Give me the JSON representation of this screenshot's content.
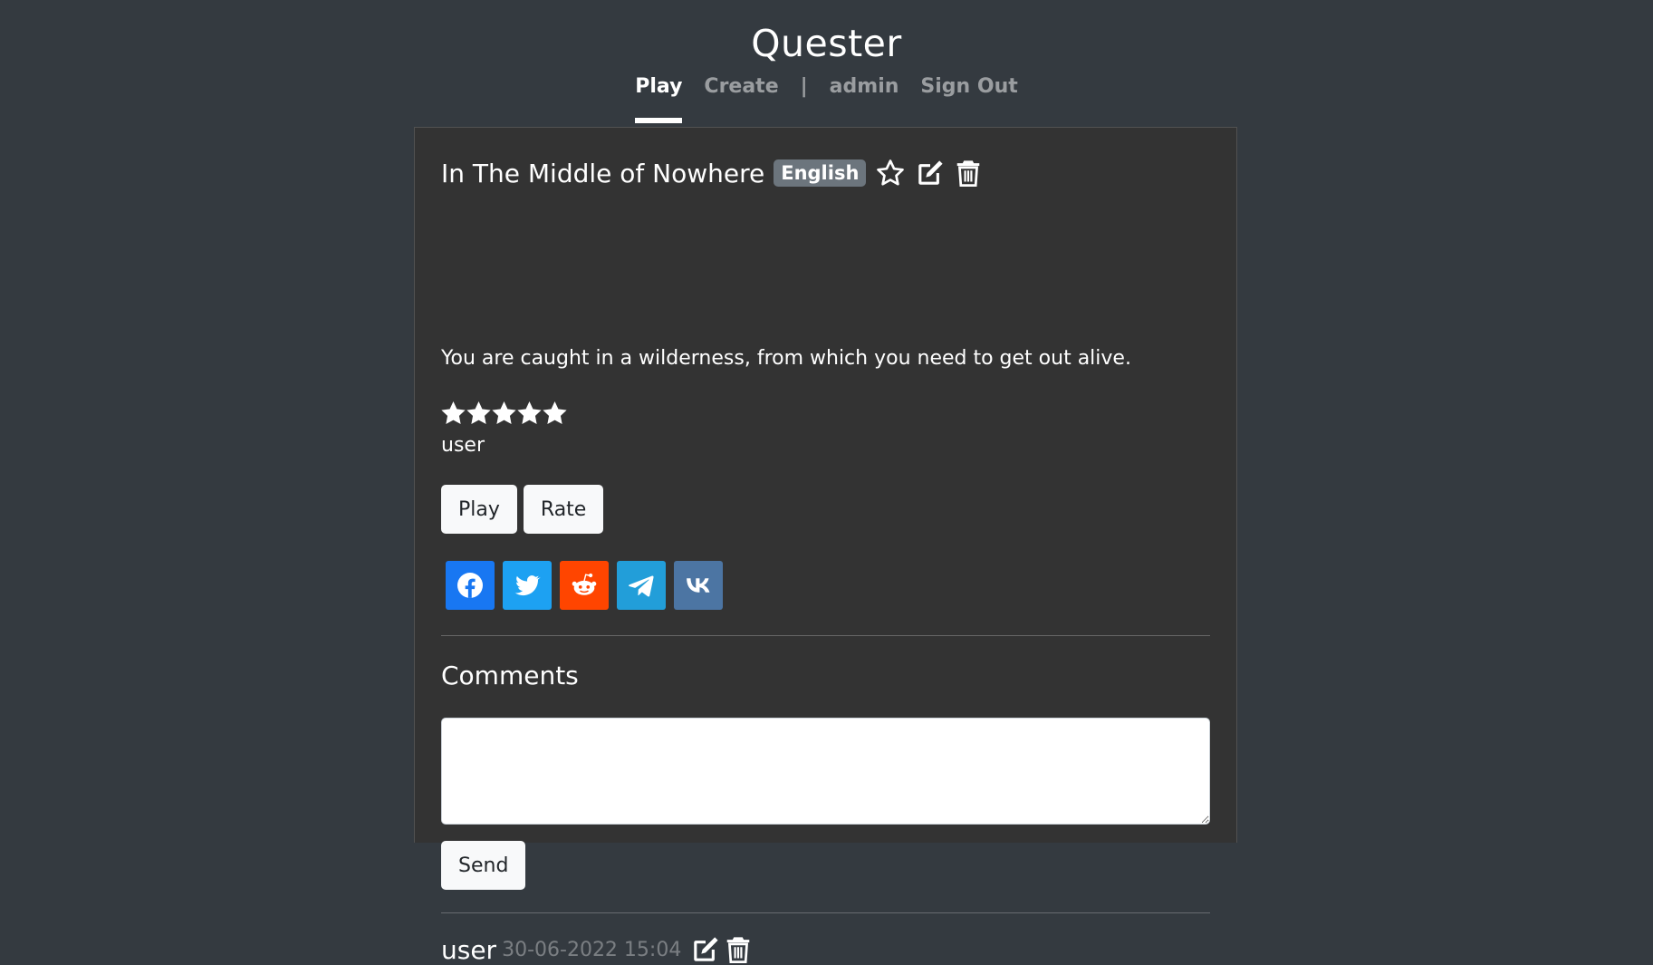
{
  "app": {
    "title": "Quester"
  },
  "nav": {
    "play": "Play",
    "create": "Create",
    "separator": "|",
    "admin": "admin",
    "signout": "Sign Out"
  },
  "quest": {
    "title": "In The Middle of Nowhere",
    "language": "English",
    "description": "You are caught in a wilderness, from which you need to get out alive.",
    "rating_stars": 5,
    "rating_max": 5,
    "author": "user",
    "play_label": "Play",
    "rate_label": "Rate"
  },
  "share": {
    "buttons": [
      {
        "icon": "facebook-icon",
        "color": "#1877f2"
      },
      {
        "icon": "twitter-icon",
        "color": "#1da1f2"
      },
      {
        "icon": "reddit-icon",
        "color": "#ff4500"
      },
      {
        "icon": "telegram-icon",
        "color": "#229ed9"
      },
      {
        "icon": "vk-icon",
        "color": "#4c75a3"
      }
    ]
  },
  "comments": {
    "heading": "Comments",
    "input_value": "",
    "send_label": "Send",
    "items": [
      {
        "user": "user",
        "date": "30-06-2022 15:04"
      }
    ]
  },
  "colors": {
    "page_bg": "#343a40",
    "card_bg": "#333333",
    "badge_bg": "#6c757d",
    "button_bg": "#f8f9fa"
  }
}
